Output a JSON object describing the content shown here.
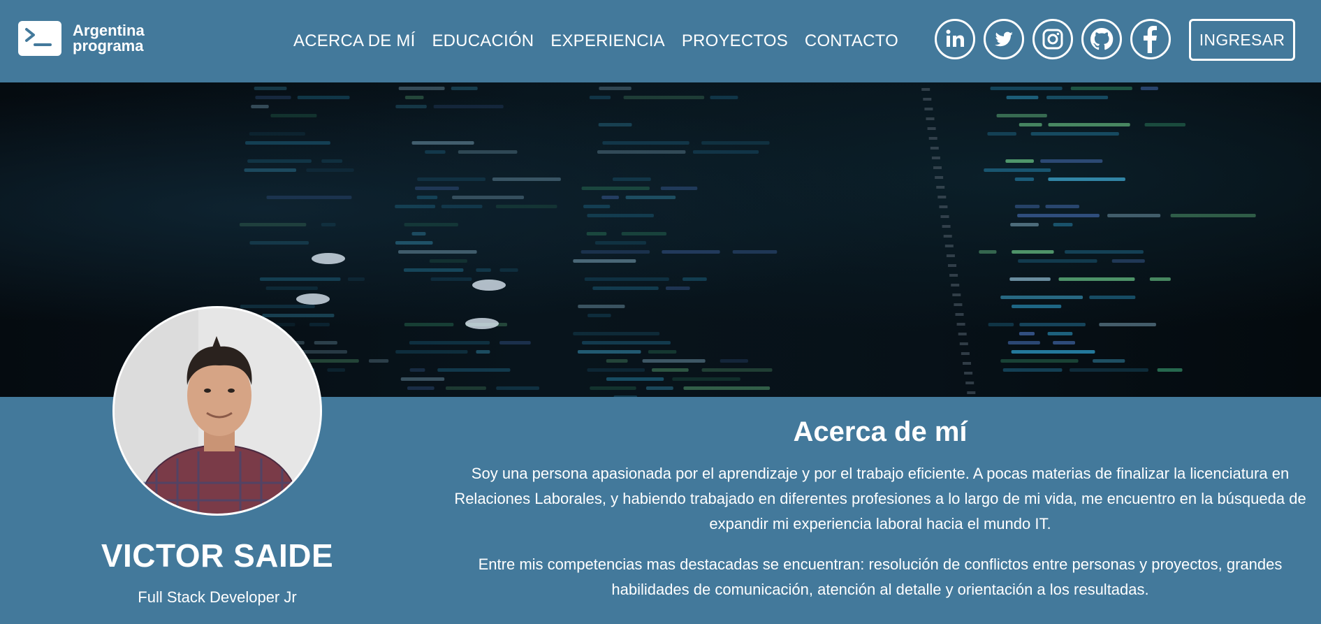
{
  "brand": {
    "line1": "Argentina",
    "line2": "programa",
    "icon": "terminal-prompt-icon"
  },
  "nav": {
    "links": [
      "ACERCA DE MÍ",
      "EDUCACIÓN",
      "EXPERIENCIA",
      "PROYECTOS",
      "CONTACTO"
    ],
    "socials": [
      "linkedin-icon",
      "twitter-icon",
      "instagram-icon",
      "github-icon",
      "facebook-icon"
    ],
    "login_label": "INGRESAR"
  },
  "profile": {
    "name": "VICTOR SAIDE",
    "role": "Full Stack Developer Jr"
  },
  "about": {
    "title": "Acerca de mí",
    "paragraph1": "Soy una persona apasionada por el aprendizaje y por el trabajo eficiente. A pocas materias de finalizar la licenciatura en Relaciones Laborales, y habiendo trabajado en diferentes profesiones a lo largo de mi vida, me encuentro en la búsqueda de expandir mi experiencia laboral hacia el mundo IT.",
    "paragraph2": "Entre mis competencias mas destacadas se encuentran: resolución de conflictos entre personas y proyectos, grandes habilidades de comunicación, atención al detalle y orientación a los resultadas."
  },
  "colors": {
    "primary": "#43799b",
    "text": "#ffffff",
    "hero_bg": "#071118"
  }
}
